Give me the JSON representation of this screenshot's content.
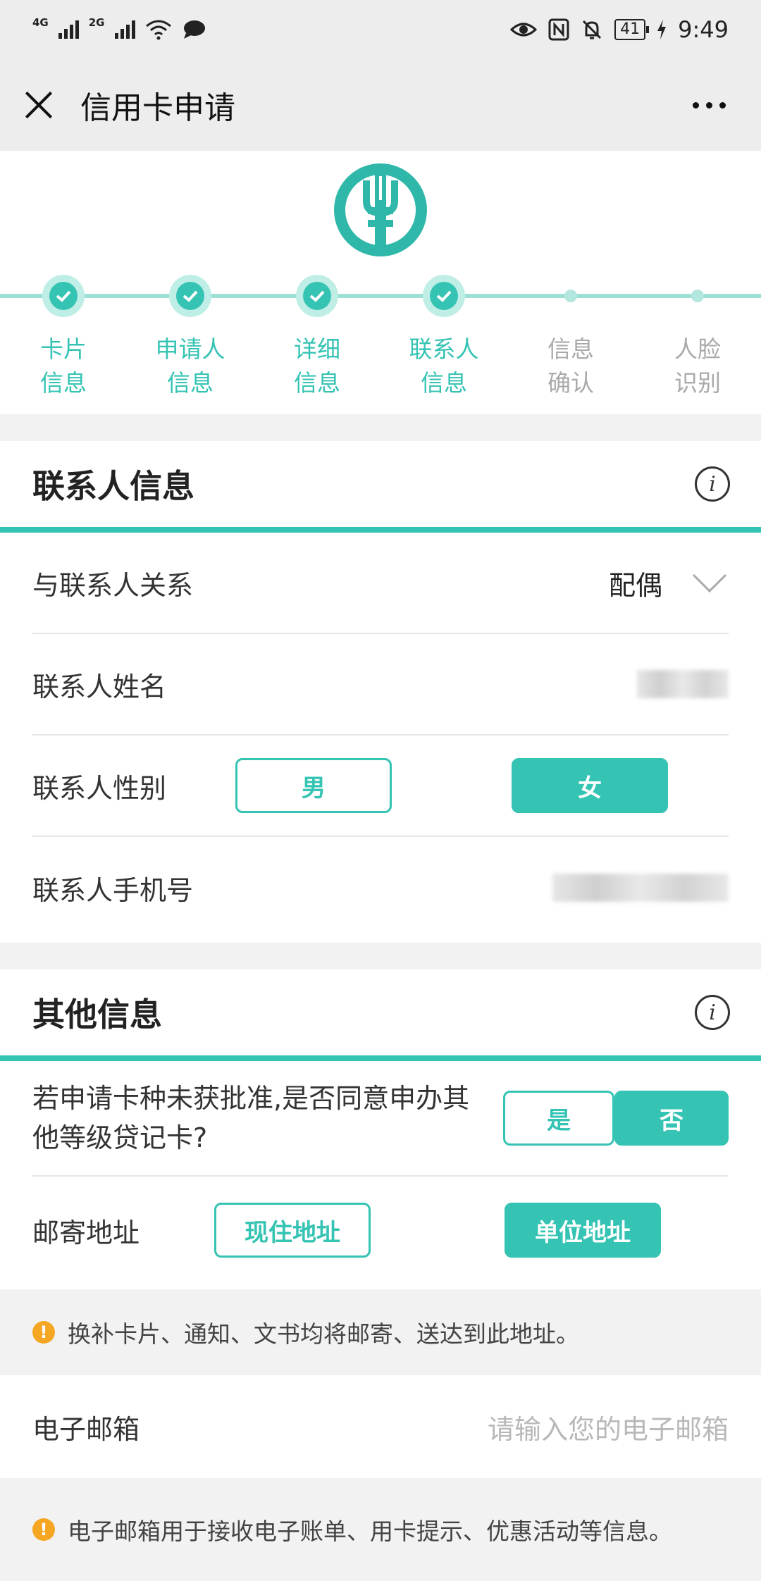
{
  "status_bar": {
    "network1": "4G",
    "network2": "2G",
    "battery": "41",
    "time": "9:49"
  },
  "titlebar": {
    "title": "信用卡申请"
  },
  "steps": [
    {
      "line1": "卡片",
      "line2": "信息",
      "done": true
    },
    {
      "line1": "申请人",
      "line2": "信息",
      "done": true
    },
    {
      "line1": "详细",
      "line2": "信息",
      "done": true
    },
    {
      "line1": "联系人",
      "line2": "信息",
      "done": true
    },
    {
      "line1": "信息",
      "line2": "确认",
      "done": false
    },
    {
      "line1": "人脸",
      "line2": "识别",
      "done": false
    }
  ],
  "contact_section": {
    "title": "联系人信息",
    "relation_label": "与联系人关系",
    "relation_value": "配偶",
    "name_label": "联系人姓名",
    "gender_label": "联系人性别",
    "gender_male": "男",
    "gender_female": "女",
    "gender_selected": "女",
    "phone_label": "联系人手机号"
  },
  "other_section": {
    "title": "其他信息",
    "question_line1": "若申请卡种未获批准,是否同意申办其",
    "question_line2": "他等级贷记卡?",
    "yes": "是",
    "no": "否",
    "answer_selected": "否",
    "mail_label": "邮寄地址",
    "mail_home": "现住地址",
    "mail_work": "单位地址",
    "mail_selected": "单位地址",
    "mail_tip": "换补卡片、通知、文书均将邮寄、送达到此地址。",
    "email_label": "电子邮箱",
    "email_placeholder": "请输入您的电子邮箱",
    "email_tip": "电子邮箱用于接收电子账单、用卡提示、优惠活动等信息。"
  },
  "colors": {
    "accent": "#35c3b3",
    "accent_light": "#9fe0d6",
    "warning": "#f5a623"
  }
}
